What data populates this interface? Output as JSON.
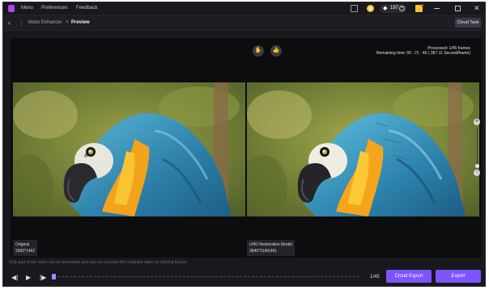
{
  "titlebar": {
    "menu": [
      "Menu",
      "Preferences",
      "Feedback"
    ],
    "credits": "197",
    "icons": {
      "logo": "app-logo",
      "feedback": "message-icon",
      "avatar": "user-avatar",
      "credits": "diamond-icon",
      "add": "plus-icon",
      "gift": "gift-icon",
      "minimize": "minimize-icon",
      "maximize": "maximize-icon",
      "close": "close-icon"
    }
  },
  "breadcrumb": {
    "back_icon": "chevron-left-icon",
    "parent": "Video Enhancer",
    "separator": ">",
    "current": "Preview",
    "cloud_task": "Cloud Task"
  },
  "preview": {
    "processed": "Processed: 1/45 frames",
    "remaining": "Remaining time: 00 : 21 : 46 ( 387.11 Second/frame)",
    "dislike_icon": "thumbs-down-icon",
    "like_icon": "thumbs-up-icon",
    "original_label": "Original",
    "original_size": "2560*1462",
    "enhanced_label": "UHD Restoration Model",
    "enhanced_size": "3840*2160(4K)",
    "zoom_in": "+",
    "zoom_out": "-",
    "zoom_level": 0.1
  },
  "notice": "Only part of the video can be previewed and you can process the complete video by clicking Export.",
  "controls": {
    "prev_icon": "previous-frame-icon",
    "play_icon": "play-icon",
    "next_icon": "next-frame-icon",
    "current_frame": 1,
    "frame_counter": "1/45",
    "cloud_export": "Cloud Export",
    "export": "Export"
  },
  "colors": {
    "accent": "#7c54ff",
    "background": "#18181d",
    "preview_bg": "#0d0d10"
  }
}
